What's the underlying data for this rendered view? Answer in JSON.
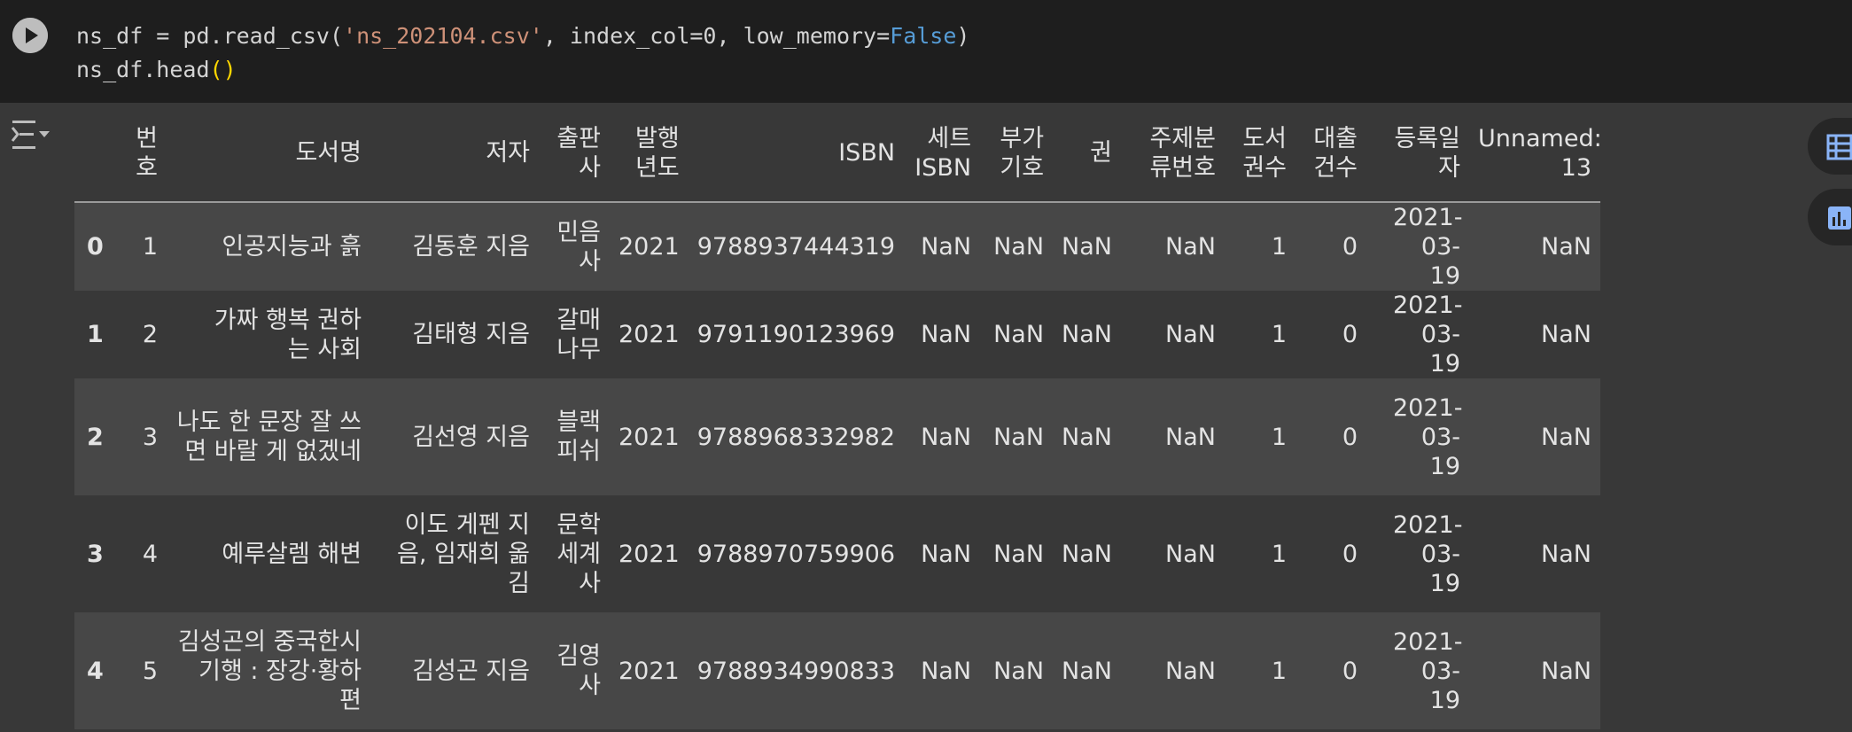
{
  "code": {
    "line1": {
      "a": "ns_df = pd.read_csv(",
      "s": "'ns_202104.csv'",
      "b": ", index_col=0, low_memory=",
      "k": "False",
      "c": ")"
    },
    "line2": {
      "a": "ns_df.head",
      "p": "()"
    }
  },
  "icons": {
    "run": "play-icon",
    "toggle": "output-toggle-icon",
    "table": "table-icon",
    "chart": "bar-chart-icon"
  },
  "table": {
    "headers": [
      "번호",
      "도서명",
      "저자",
      "출판사",
      "발행년도",
      "ISBN",
      "세트 ISBN",
      "부가기호",
      "권",
      "주제분류번호",
      "도서권수",
      "대출건수",
      "등록일자",
      "Unnamed: 13"
    ],
    "rows": [
      [
        "0",
        "1",
        "인공지능과 흙",
        "김동훈 지음",
        "민음사",
        "2021",
        "9788937444319",
        "NaN",
        "NaN",
        "NaN",
        "NaN",
        "1",
        "0",
        "2021-03-19",
        "NaN"
      ],
      [
        "1",
        "2",
        "가짜 행복 권하는 사회",
        "김태형 지음",
        "갈매나무",
        "2021",
        "9791190123969",
        "NaN",
        "NaN",
        "NaN",
        "NaN",
        "1",
        "0",
        "2021-03-19",
        "NaN"
      ],
      [
        "2",
        "3",
        "나도 한 문장 잘 쓰면 바랄 게 없겠네",
        "김선영 지음",
        "블랙피쉬",
        "2021",
        "9788968332982",
        "NaN",
        "NaN",
        "NaN",
        "NaN",
        "1",
        "0",
        "2021-03-19",
        "NaN"
      ],
      [
        "3",
        "4",
        "예루살렘 해변",
        "이도 게펜 지음, 임재희 옮김",
        "문학세계사",
        "2021",
        "9788970759906",
        "NaN",
        "NaN",
        "NaN",
        "NaN",
        "1",
        "0",
        "2021-03-19",
        "NaN"
      ],
      [
        "4",
        "5",
        "김성곤의 중국한시기행 : 장강·황하 편",
        "김성곤 지음",
        "김영사",
        "2021",
        "9788934990833",
        "NaN",
        "NaN",
        "NaN",
        "NaN",
        "1",
        "0",
        "2021-03-19",
        "NaN"
      ]
    ]
  }
}
